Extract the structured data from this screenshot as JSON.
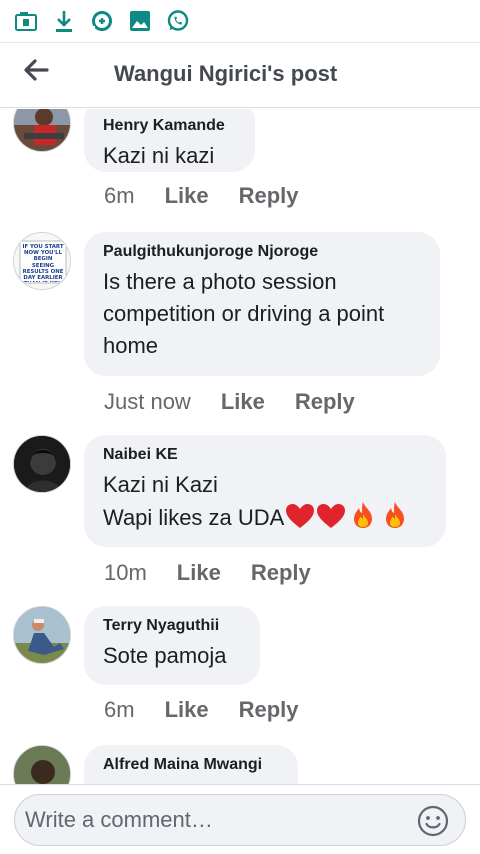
{
  "status_bar": {
    "icons": [
      "sim-card-icon",
      "download-icon",
      "data-saver-icon",
      "image-icon",
      "whatsapp-icon"
    ]
  },
  "header": {
    "title": "Wangui Ngirici's post",
    "back_icon": "arrow-left-icon"
  },
  "comments": [
    {
      "author": "Henry Kamande",
      "text": "Kazi ni kazi",
      "time": "6m",
      "like_label": "Like",
      "reply_label": "Reply"
    },
    {
      "author": "Paulgithukunjoroge Njoroge",
      "text": "Is there a photo session competition or driving a point home",
      "time": "Just now",
      "like_label": "Like",
      "reply_label": "Reply",
      "avatar_text": "IF YOU START NOW YOU'LL BEGIN SEEING RESULTS ONE DAY EARLIER THAN IF YOU START TOMORROW"
    },
    {
      "author": "Naibei KE",
      "line1": "Kazi ni Kazi",
      "line2": "Wapi likes za UDA",
      "emojis": [
        "red-heart",
        "red-heart",
        "fire",
        "fire"
      ],
      "time": "10m",
      "like_label": "Like",
      "reply_label": "Reply"
    },
    {
      "author": "Terry Nyaguthii",
      "text": "Sote pamoja",
      "time": "6m",
      "like_label": "Like",
      "reply_label": "Reply"
    },
    {
      "author": "Alfred Maina Mwangi"
    }
  ],
  "composer": {
    "placeholder": "Write a comment…",
    "emoji_icon": "smiley-icon"
  },
  "colors": {
    "bubble": "#f0f2f5",
    "muted_text": "#65676b",
    "status_icon": "#0d8a83"
  }
}
